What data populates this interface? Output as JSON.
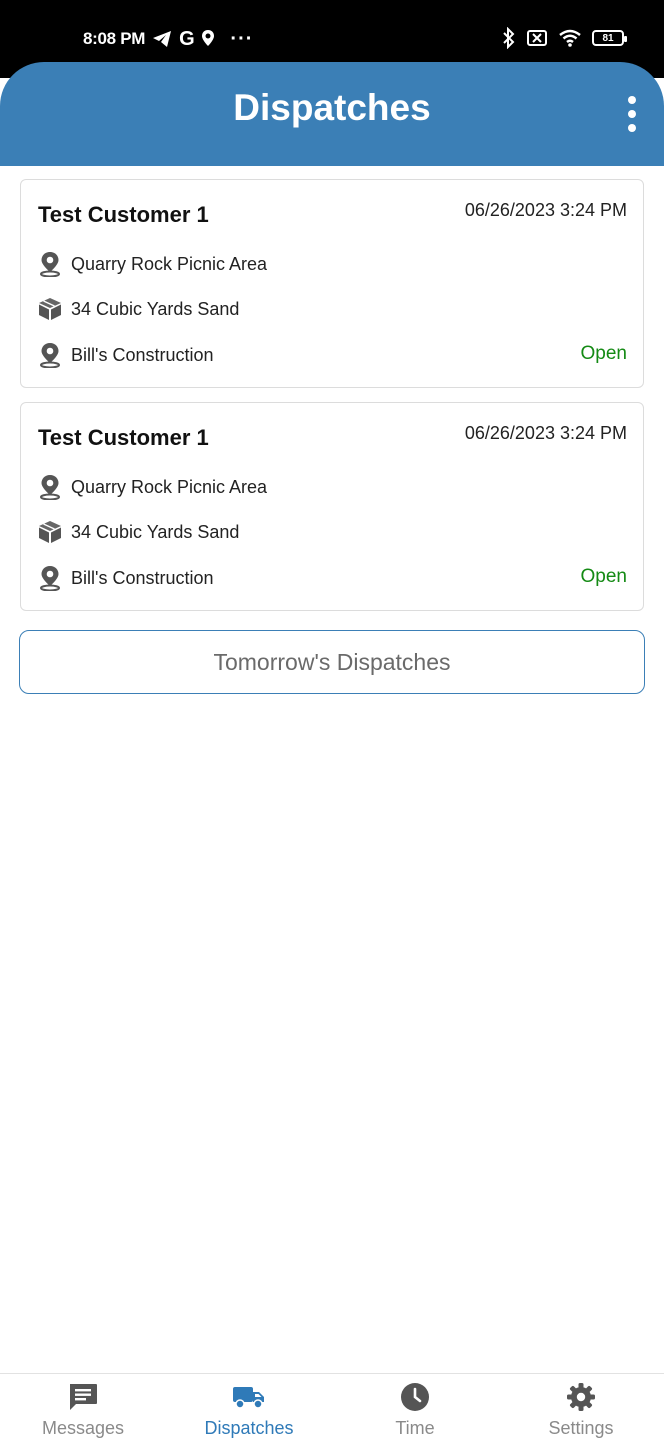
{
  "status_bar": {
    "time": "8:08 PM",
    "g_label": "G",
    "more": "···",
    "battery": "81"
  },
  "header": {
    "title": "Dispatches"
  },
  "dispatches": [
    {
      "customer": "Test Customer 1",
      "datetime": "06/26/2023 3:24 PM",
      "location": "Quarry Rock Picnic Area",
      "material": "34 Cubic Yards Sand",
      "supplier": "Bill's Construction",
      "status": "Open"
    },
    {
      "customer": "Test Customer 1",
      "datetime": "06/26/2023 3:24 PM",
      "location": "Quarry Rock Picnic Area",
      "material": "34 Cubic Yards Sand",
      "supplier": "Bill's Construction",
      "status": "Open"
    }
  ],
  "tomorrow_button": "Tomorrow's Dispatches",
  "nav": {
    "items": [
      {
        "label": "Messages",
        "icon": "message-icon"
      },
      {
        "label": "Dispatches",
        "icon": "truck-icon",
        "active": true
      },
      {
        "label": "Time",
        "icon": "clock-icon"
      },
      {
        "label": "Settings",
        "icon": "gear-icon"
      }
    ]
  },
  "colors": {
    "primary": "#3b7fb6",
    "status_open": "#148a14",
    "active_nav": "#2f7ab8",
    "inactive_nav": "#8a8a8a"
  }
}
